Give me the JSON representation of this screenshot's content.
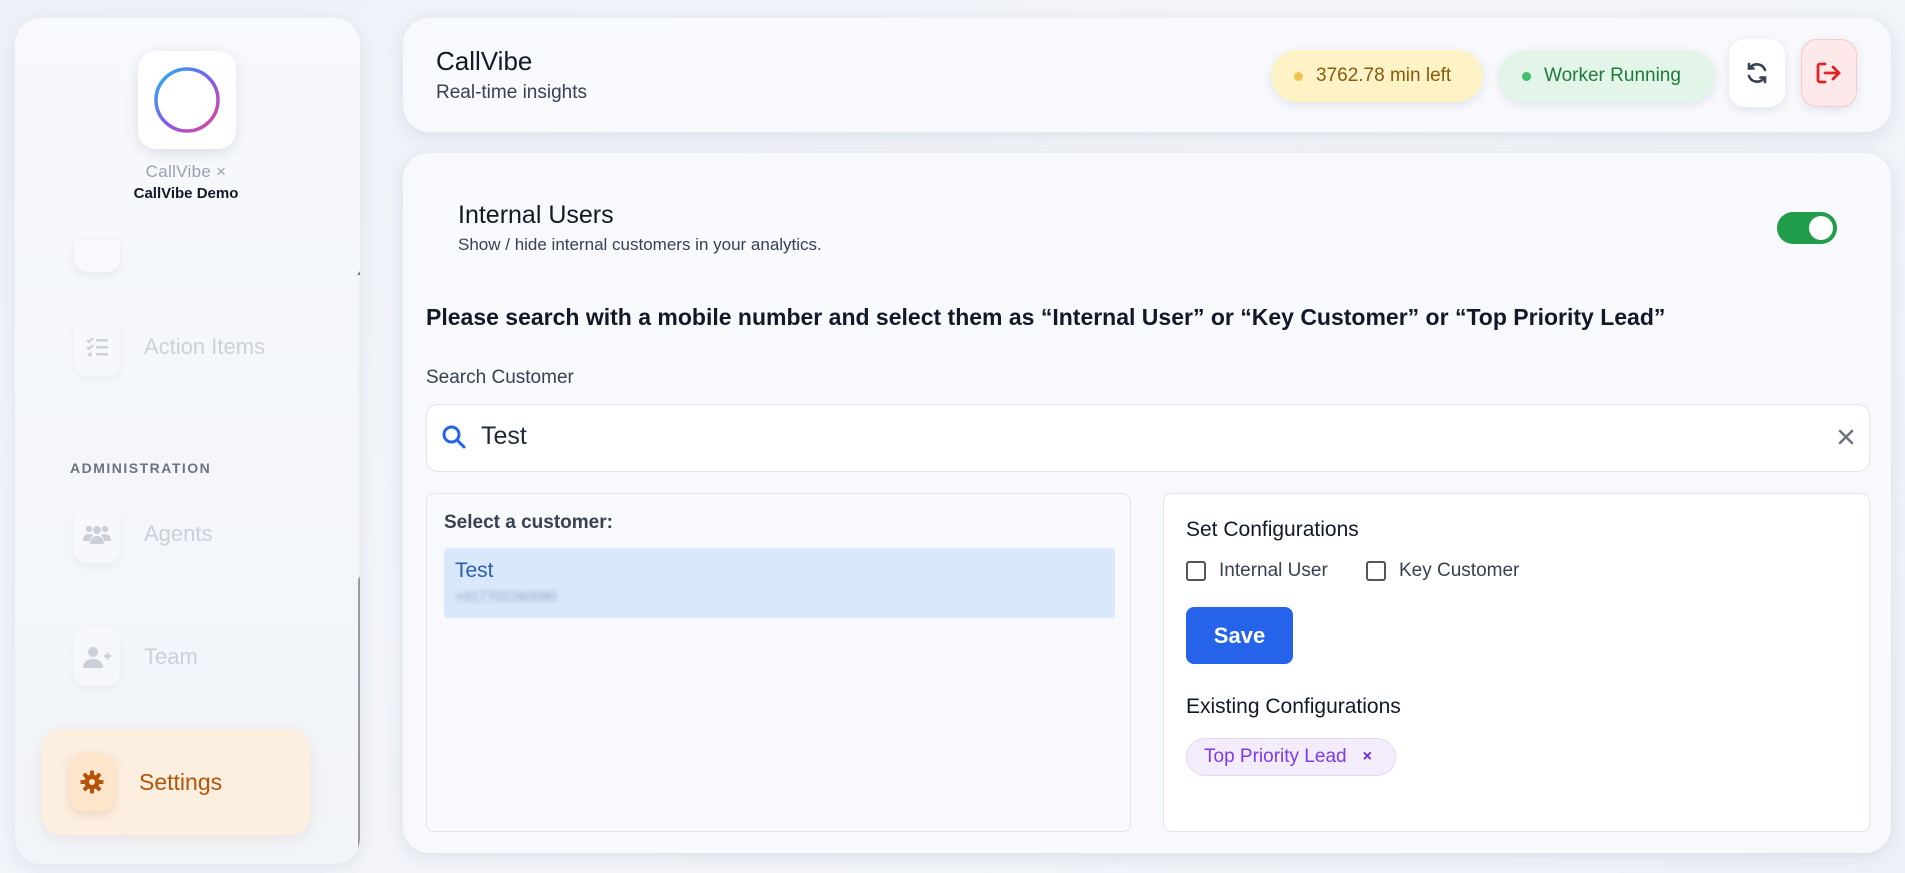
{
  "colors": {
    "accent_blue": "#2563eb",
    "active_nav_bg": "#fcefe0",
    "active_nav_text": "#b45309",
    "toggle_on": "#1f9d4b",
    "tag_purple": "#7c3aed"
  },
  "sidebar": {
    "brand_line1": "CallVibe ×",
    "brand_line2": "CallVibe Demo",
    "logo_icon": "soundwave-logo-icon",
    "items": [
      {
        "label": "Action Items",
        "icon": "checklist-icon"
      },
      {
        "label": "Agents",
        "icon": "users-icon"
      },
      {
        "label": "Team",
        "icon": "user-plus-icon"
      },
      {
        "label": "Settings",
        "icon": "gear-icon",
        "active": true
      }
    ],
    "section_label": "ADMINISTRATION"
  },
  "header": {
    "title": "CallVibe",
    "subtitle": "Real-time insights",
    "minutes_left": "3762.78 min left",
    "worker_status": "Worker Running",
    "refresh_icon": "refresh-icon",
    "logout_icon": "logout-icon"
  },
  "main": {
    "section_title": "Internal Users",
    "section_desc": "Show / hide internal customers in your analytics.",
    "toggle_on": true,
    "instruction": "Please search with a mobile number and select them as “Internal User” or “Key Customer” or “Top Priority Lead”",
    "search": {
      "label": "Search Customer",
      "value": "Test"
    },
    "customer_list": {
      "label": "Select a customer:",
      "items": [
        {
          "name": "Test",
          "phone": "+917702260090"
        }
      ]
    },
    "config": {
      "title": "Set Configurations",
      "options": [
        {
          "label": "Internal User",
          "checked": false
        },
        {
          "label": "Key Customer",
          "checked": false
        }
      ],
      "save_label": "Save",
      "existing_title": "Existing Configurations",
      "existing": [
        {
          "label": "Top Priority Lead",
          "remove": "×"
        }
      ]
    }
  }
}
